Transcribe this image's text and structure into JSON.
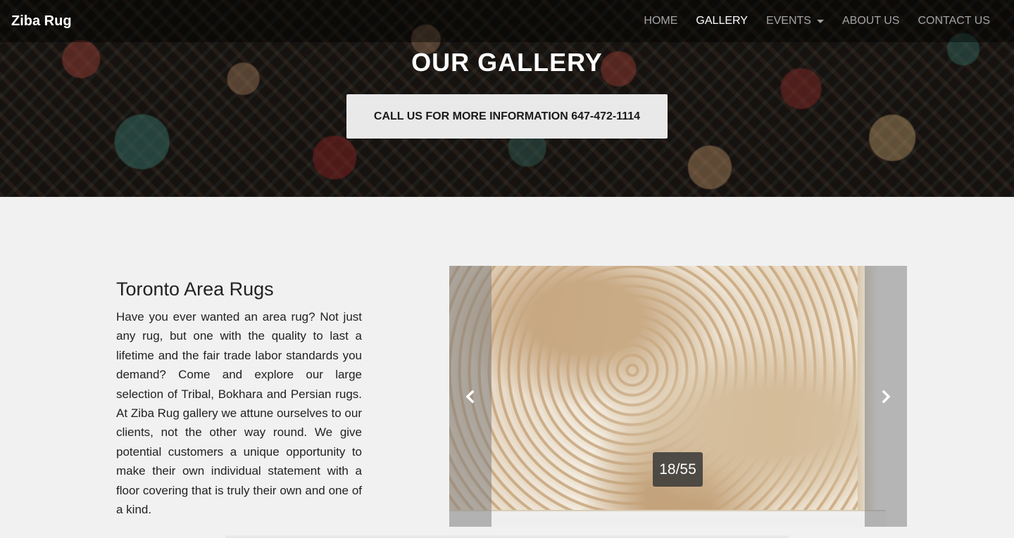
{
  "navbar": {
    "brand": "Ziba Rug",
    "links": [
      {
        "label": "HOME",
        "active": false
      },
      {
        "label": "GALLERY",
        "active": true
      },
      {
        "label": "EVENTS",
        "active": false,
        "dropdown": true
      },
      {
        "label": "ABOUT US",
        "active": false
      },
      {
        "label": "CONTACT US",
        "active": false
      }
    ]
  },
  "hero": {
    "title": "OUR GALLERY",
    "cta_label": "CALL US FOR MORE INFORMATION 647-472-1114"
  },
  "main": {
    "title": "Toronto Area Rugs",
    "text": "Have you ever wanted an area rug? Not just any rug, but one with the quality to last a lifetime and the fair trade labor standards you demand? Come and explore our large selection of Tribal, Bokhara and Persian rugs. At Ziba Rug gallery we attune ourselves to our clients, not the other way round. We give potential customers a unique opportunity to make their own individual statement with a floor covering that is truly their own and one of a kind."
  },
  "carousel": {
    "counter": "18/55",
    "current": 18,
    "total": 55,
    "prev_icon": "chevron-left-icon",
    "next_icon": "chevron-right-icon"
  },
  "colors": {
    "page_background": "#f1f1f1",
    "cta_background": "#e9e9e9",
    "nav_active": "#ffffff"
  }
}
